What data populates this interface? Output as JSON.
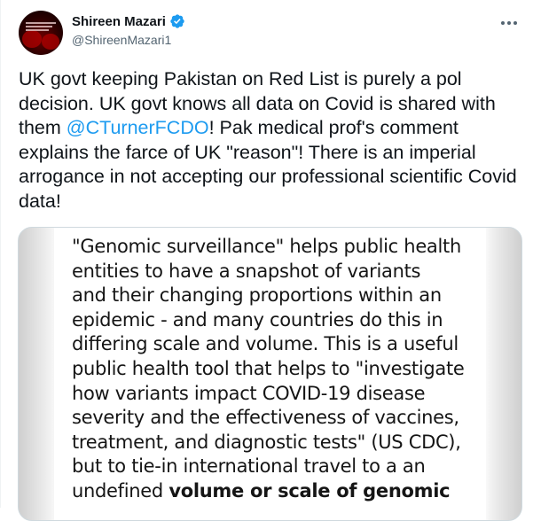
{
  "tweet": {
    "author": {
      "display_name": "Shireen Mazari",
      "handle": "@ShireenMazari1",
      "verified": true
    },
    "text_parts": {
      "before_mention": "UK govt keeping Pakistan on Red List is purely a pol decision. UK govt knows all data on Covid is shared with them ",
      "mention": "@CTurnerFCDO",
      "after_mention": "! Pak medical prof's comment explains the farce of UK \"reason\"! There is an imperial arrogance in not accepting our professional scientific Covid data!"
    },
    "media": {
      "text_main": "\"Genomic surveillance\" helps public health\nentities to have a snapshot of variants\nand their changing proportions within an\nepidemic - and many countries do this in\ndiffering scale and volume. This is a useful\npublic health tool that helps to \"investigate\nhow variants impact COVID-19 disease\nseverity and the effectiveness of vaccines,\ntreatment, and diagnostic tests\" (US CDC),\nbut to tie-in international travel to a an\nundefined ",
      "text_bold": "volume or scale of genomic"
    }
  },
  "colors": {
    "text": "#0f1419",
    "secondary": "#536471",
    "accent": "#1d9bf0",
    "border": "#cfd9de"
  },
  "icons": {
    "verified": "verified-badge-icon",
    "more": "more-options-icon"
  }
}
